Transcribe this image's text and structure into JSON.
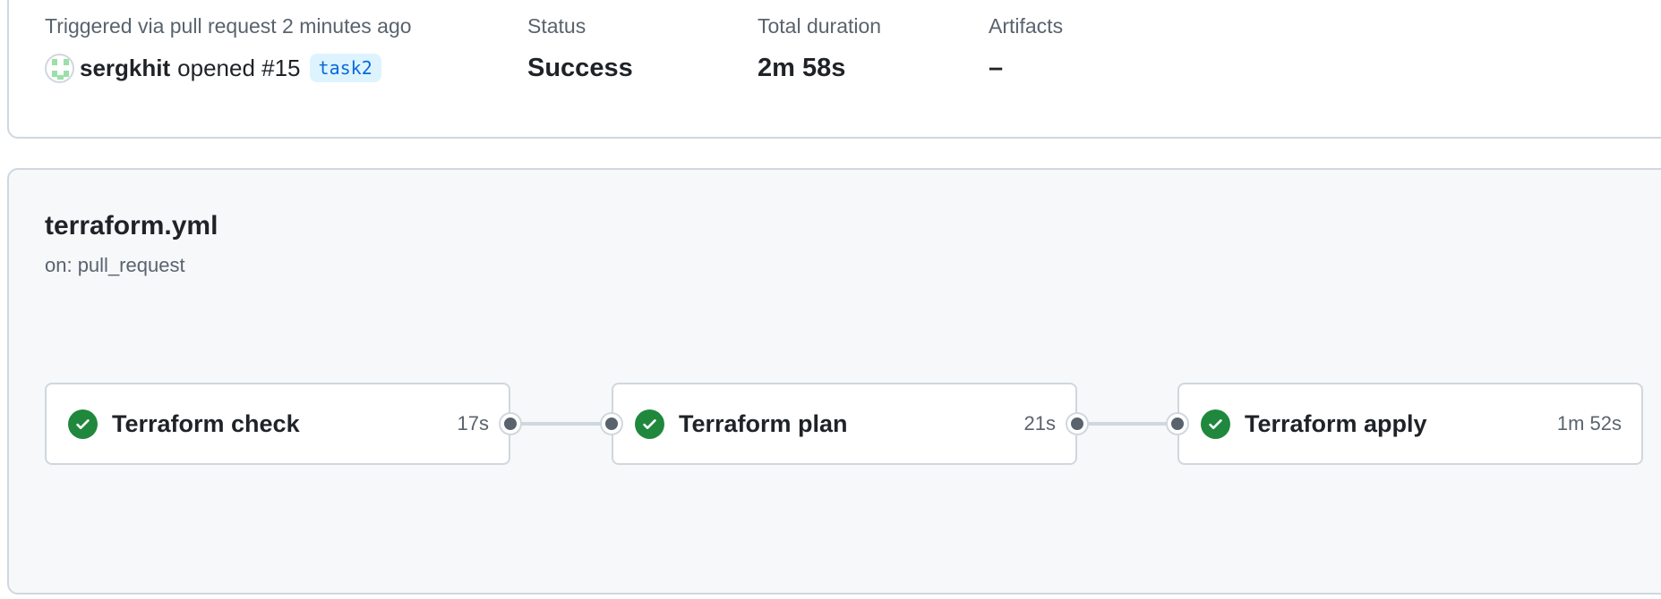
{
  "summary": {
    "trigger_label": "Triggered via pull request 2 minutes ago",
    "actor": "sergkhit",
    "action": "opened #15",
    "branch": "task2",
    "status_label": "Status",
    "status_value": "Success",
    "duration_label": "Total duration",
    "duration_value": "2m 58s",
    "artifacts_label": "Artifacts",
    "artifacts_value": "–"
  },
  "workflow": {
    "file": "terraform.yml",
    "trigger": "on: pull_request",
    "jobs": [
      {
        "name": "Terraform check",
        "duration": "17s",
        "status": "success",
        "icon": "check-circle-icon"
      },
      {
        "name": "Terraform plan",
        "duration": "21s",
        "status": "success",
        "icon": "check-circle-icon"
      },
      {
        "name": "Terraform apply",
        "duration": "1m 52s",
        "status": "success",
        "icon": "check-circle-icon"
      }
    ]
  },
  "colors": {
    "success": "#1f883d",
    "branch_bg": "#ddf4ff",
    "branch_text": "#0969da",
    "border": "#d0d7de",
    "muted": "#59636e",
    "graph_bg": "#f6f8fa"
  }
}
